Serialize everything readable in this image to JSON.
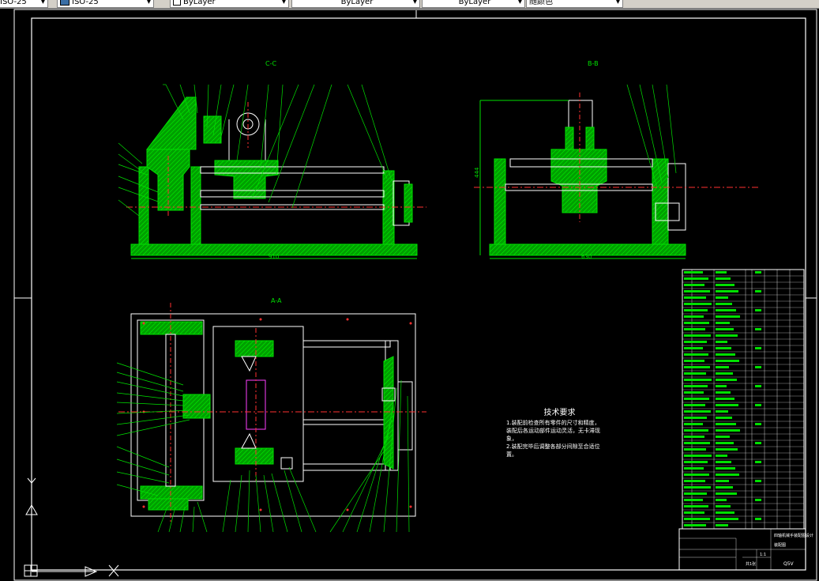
{
  "toolbar": {
    "items": [
      {
        "label": "ISO-25",
        "kind": "text"
      },
      {
        "label": "ISO-25",
        "kind": "icon"
      },
      {
        "label": "ByLayer",
        "kind": "swatch"
      },
      {
        "label": "ByLayer",
        "kind": "text"
      },
      {
        "label": "ByLayer",
        "kind": "text"
      },
      {
        "label": "随颜色",
        "kind": "text"
      }
    ]
  },
  "views": {
    "cc_label": "C-C",
    "bb_label": "B-B",
    "aa_label": "A-A"
  },
  "dimensions": {
    "cc_width": "910",
    "bb_width": "630",
    "bb_height": "444"
  },
  "tech_requirements": {
    "title": "技术要求",
    "line1": "1.装配前检查所有零件的尺寸和精度，装配后各运动部件运动灵活，无卡滞现象，",
    "line2": "2.装配完毕后调整各部分间隙至合适位置。"
  },
  "title_block": {
    "project": "四轴机械手装配图设计",
    "drawing_no": "装配图",
    "scale": "1:1",
    "sheet": "共1张",
    "code": "Q5V"
  },
  "colors": {
    "geometry": "#00e000",
    "hatch": "#00c000",
    "outline": "#ffffff",
    "center_line": "#ff3030",
    "background": "#000000"
  }
}
